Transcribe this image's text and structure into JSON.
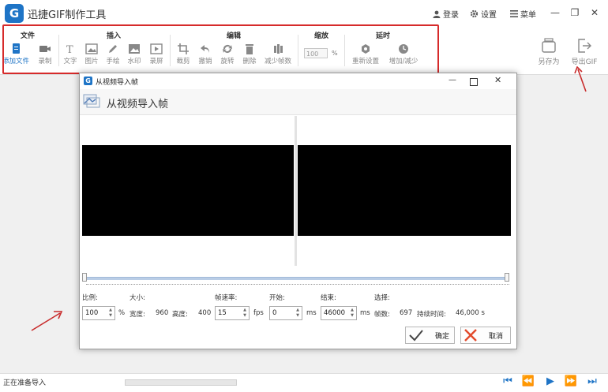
{
  "app": {
    "title": "迅捷GIF制作工具",
    "logo_letter": "G"
  },
  "top_actions": {
    "login": "登录",
    "settings": "设置",
    "menu": "菜单"
  },
  "toolbar": {
    "groups": {
      "file": "文件",
      "insert": "插入",
      "edit": "编辑",
      "zoom": "缩放",
      "delay": "延时"
    },
    "tools": {
      "add_file": "添加文件",
      "record": "录制",
      "text": "文字",
      "image": "图片",
      "draw": "手绘",
      "watermark": "水印",
      "screen": "录屏",
      "crop": "裁剪",
      "undo": "撤销",
      "rotate": "旋转",
      "delete": "删除",
      "reduce_frames": "减少帧数",
      "zoom_value": "100",
      "zoom_unit": "%",
      "reset": "重新设置",
      "add_reduce": "增加/减少"
    },
    "right": {
      "save_as": "另存为",
      "export_gif": "导出GIF"
    }
  },
  "dialog": {
    "window_title": "从视频导入帧",
    "header_title": "从视频导入帧",
    "labels": {
      "scale": "比例:",
      "size": "大小:",
      "framerate": "帧速率:",
      "start": "开始:",
      "end": "结束:",
      "select": "选择:"
    },
    "scale_value": "100",
    "scale_unit": "%",
    "width_label": "宽度:",
    "width_value": "960",
    "height_label": "高度:",
    "height_value": "400",
    "fps_value": "15",
    "fps_unit": "fps",
    "start_value": "0",
    "start_unit": "ms",
    "end_value": "46000",
    "end_unit": "ms",
    "frames_label": "帧数:",
    "frames_value": "697",
    "duration_label": "持续时间:",
    "duration_value": "46,000 s",
    "ok": "确定",
    "cancel": "取消"
  },
  "status": {
    "text": "正在准备导入"
  },
  "colors": {
    "accent": "#1e74c6",
    "annotation": "#d62b2b"
  }
}
